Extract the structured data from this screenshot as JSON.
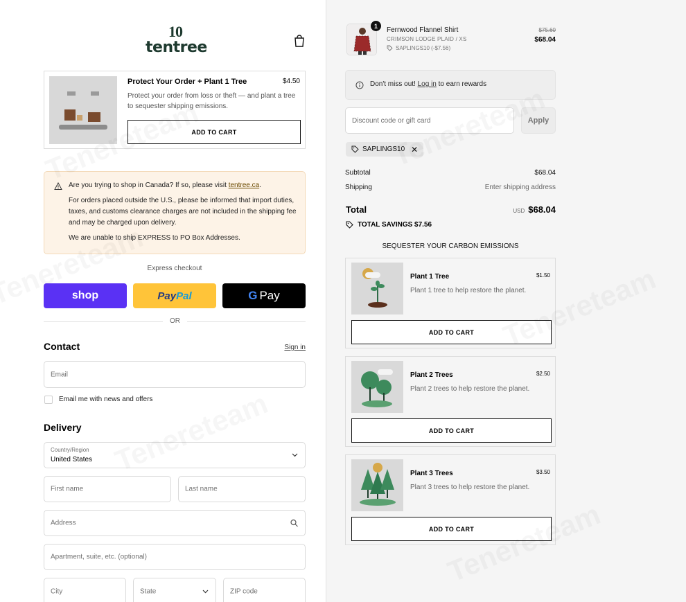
{
  "header": {
    "logo_top": "10",
    "logo_bottom": "tentree",
    "bag_icon": "shopping-bag-icon"
  },
  "protect": {
    "title": "Protect Your Order + Plant 1 Tree",
    "price": "$4.50",
    "description": "Protect your order from loss or theft — and plant a tree to sequester shipping emissions.",
    "button": "ADD TO CART"
  },
  "notice": {
    "line1_prefix": "Are you trying to shop in Canada? If so, please visit ",
    "line1_link": "tentree.ca",
    "line1_suffix": ".",
    "para2": "For orders placed outside the U.S., please be informed that import duties, taxes, and customs clearance charges are not included in the shipping fee and may be charged upon delivery.",
    "para3": "We are unable to ship EXPRESS to PO Box Addresses."
  },
  "express": {
    "label": "Express checkout",
    "shop": "shop",
    "paypal_a": "Pay",
    "paypal_b": "Pal",
    "gpay_g": "G",
    "gpay": "Pay",
    "or": "OR"
  },
  "contact": {
    "title": "Contact",
    "signin": "Sign in",
    "email_placeholder": "Email",
    "newsletter": "Email me with news and offers"
  },
  "delivery": {
    "title": "Delivery",
    "country_label": "Country/Region",
    "country_value": "United States",
    "first_name": "First name",
    "last_name": "Last name",
    "address": "Address",
    "apartment": "Apartment, suite, etc. (optional)",
    "city": "City",
    "state": "State",
    "zip": "ZIP code"
  },
  "cart_item": {
    "qty": "1",
    "name": "Fernwood Flannel Shirt",
    "variant": "CRIMSON LODGE PLAID / XS",
    "discount": "SAPLINGS10 (-$7.56)",
    "old_price": "$75.60",
    "price": "$68.04"
  },
  "rewards": {
    "prefix": "Don't miss out! ",
    "link": "Log in",
    "suffix": " to earn rewards"
  },
  "discount": {
    "placeholder": "Discount code or gift card",
    "apply": "Apply",
    "code": "SAPLINGS10"
  },
  "summary": {
    "subtotal_label": "Subtotal",
    "subtotal": "$68.04",
    "shipping_label": "Shipping",
    "shipping": "Enter shipping address",
    "total_label": "Total",
    "currency": "USD",
    "total": "$68.04",
    "savings": "TOTAL SAVINGS $7.56"
  },
  "carbon": {
    "title": "SEQUESTER YOUR CARBON EMISSIONS",
    "items": [
      {
        "name": "Plant 1 Tree",
        "price": "$1.50",
        "desc": "Plant 1 tree to help restore the planet.",
        "button": "ADD TO CART"
      },
      {
        "name": "Plant 2 Trees",
        "price": "$2.50",
        "desc": "Plant 2 trees to help restore the planet.",
        "button": "ADD TO CART"
      },
      {
        "name": "Plant 3 Trees",
        "price": "$3.50",
        "desc": "Plant 3 trees to help restore the planet.",
        "button": "ADD TO CART"
      }
    ]
  },
  "colors": {
    "shop": "#5a31f4",
    "paypal": "#ffc439",
    "gpay": "#000000",
    "notice_bg": "#fdf3e7",
    "brand": "#1e3a2f"
  },
  "watermark": "Tenereteam"
}
